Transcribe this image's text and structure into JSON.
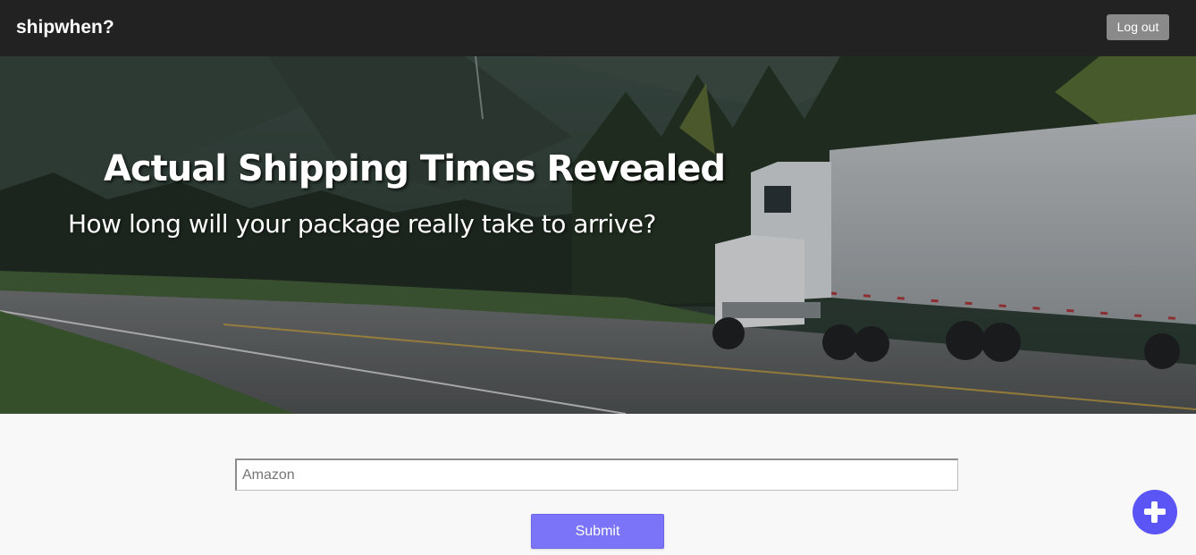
{
  "navbar": {
    "brand": "shipwhen?",
    "logout_label": "Log out"
  },
  "hero": {
    "title": "Actual Shipping Times Revealed",
    "subtitle": "How long will your package really take to arrive?",
    "image": "truck-on-mountain-highway"
  },
  "form": {
    "search_placeholder": "Amazon",
    "search_value": "",
    "submit_label": "Submit"
  },
  "fab": {
    "icon": "plus-icon"
  },
  "colors": {
    "navbar_bg": "#222222",
    "logout_bg": "#8a8a8a",
    "submit_bg": "#7b74f8",
    "fab_bg": "#5b55f5",
    "page_bg": "#f8f8f8"
  }
}
